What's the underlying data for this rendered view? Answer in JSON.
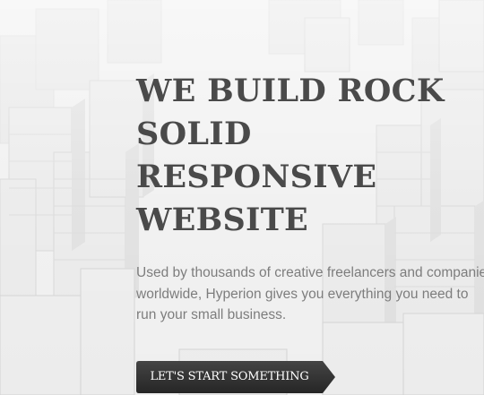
{
  "hero": {
    "headline_lines": [
      "WE BUILD ROCK",
      "SOLID",
      "RESPONSIVE",
      "WEBSITE"
    ],
    "description_lines": [
      "Used by thousands of creative freelancers and companies",
      "worldwide, Hyperion gives you everything you need to",
      "run your small business."
    ],
    "cta_label": "LET'S START SOMETHING"
  },
  "colors": {
    "background": "#f1f1f1",
    "headline": "#4a4a4a",
    "description": "#7d7d7d",
    "cta_background": "#2f2f2f",
    "cta_text": "#ffffff"
  },
  "icons": {
    "cta_arrow": "arrow-right-shape-icon"
  }
}
